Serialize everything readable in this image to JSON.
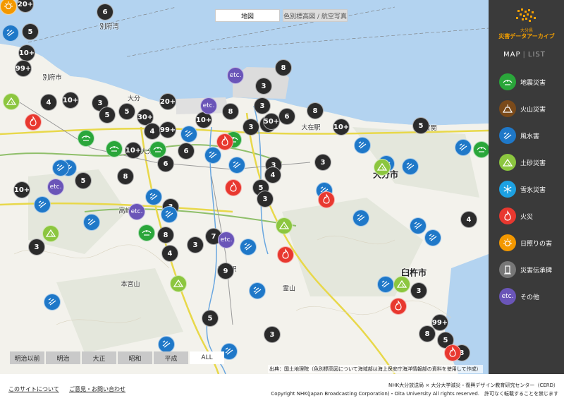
{
  "map_toggle": {
    "map": "地図",
    "terrain": "色別標高図 / 航空写真"
  },
  "places": [
    {
      "name": "大分市",
      "cls": "big"
    },
    {
      "name": "臼杵市",
      "cls": "big"
    },
    {
      "name": "別府市",
      "cls": ""
    },
    {
      "name": "大分",
      "cls": ""
    },
    {
      "name": "大分駅",
      "cls": ""
    },
    {
      "name": "別府湾",
      "cls": ""
    },
    {
      "name": "高崎山",
      "cls": ""
    },
    {
      "name": "本宮山",
      "cls": ""
    },
    {
      "name": "霊山",
      "cls": ""
    },
    {
      "name": "鶴崎駅",
      "cls": ""
    },
    {
      "name": "大在駅",
      "cls": ""
    },
    {
      "name": "佐賀関",
      "cls": ""
    }
  ],
  "markers": [
    {
      "kind": "cluster",
      "label": "20+"
    },
    {
      "kind": "cluster",
      "label": "6"
    },
    {
      "kind": "cluster",
      "label": "5"
    },
    {
      "kind": "cluster",
      "label": "10+"
    },
    {
      "kind": "cluster",
      "label": "99+"
    },
    {
      "kind": "cluster",
      "label": "8"
    },
    {
      "kind": "cluster",
      "label": "3"
    },
    {
      "kind": "cluster",
      "label": "4"
    },
    {
      "kind": "cluster",
      "label": "10+"
    },
    {
      "kind": "cluster",
      "label": "3"
    },
    {
      "kind": "cluster",
      "label": "5"
    },
    {
      "kind": "cluster",
      "label": "5"
    },
    {
      "kind": "cluster",
      "label": "30+"
    },
    {
      "kind": "cluster",
      "label": "4"
    },
    {
      "kind": "cluster",
      "label": "20+"
    },
    {
      "kind": "cluster",
      "label": "8"
    },
    {
      "kind": "cluster",
      "label": "99+"
    },
    {
      "kind": "cluster",
      "label": "5"
    },
    {
      "kind": "cluster",
      "label": "10+"
    },
    {
      "kind": "cluster",
      "label": "3"
    },
    {
      "kind": "cluster",
      "label": "3"
    },
    {
      "kind": "cluster",
      "label": "50+"
    },
    {
      "kind": "cluster",
      "label": "6"
    },
    {
      "kind": "cluster",
      "label": "8"
    },
    {
      "kind": "cluster",
      "label": "10+"
    },
    {
      "kind": "cluster",
      "label": "5"
    },
    {
      "kind": "cluster",
      "label": "10+"
    },
    {
      "kind": "cluster",
      "label": "6"
    },
    {
      "kind": "cluster",
      "label": "3"
    },
    {
      "kind": "cluster",
      "label": "6"
    },
    {
      "kind": "cluster",
      "label": "5"
    },
    {
      "kind": "cluster",
      "label": "8"
    },
    {
      "kind": "cluster",
      "label": "3"
    },
    {
      "kind": "cluster",
      "label": "4"
    },
    {
      "kind": "cluster",
      "label": "5"
    },
    {
      "kind": "cluster",
      "label": "3"
    },
    {
      "kind": "cluster",
      "label": "3"
    },
    {
      "kind": "cluster",
      "label": "10+"
    },
    {
      "kind": "cluster",
      "label": "3"
    },
    {
      "kind": "cluster",
      "label": "8"
    },
    {
      "kind": "cluster",
      "label": "7"
    },
    {
      "kind": "cluster",
      "label": "3"
    },
    {
      "kind": "cluster",
      "label": "4"
    },
    {
      "kind": "cluster",
      "label": "9"
    },
    {
      "kind": "cluster",
      "label": "5"
    },
    {
      "kind": "cluster",
      "label": "3"
    },
    {
      "kind": "cluster",
      "label": "4"
    },
    {
      "kind": "cluster",
      "label": "3"
    },
    {
      "kind": "cluster",
      "label": "8"
    },
    {
      "kind": "cluster",
      "label": "99+"
    },
    {
      "kind": "cluster",
      "label": "5"
    },
    {
      "kind": "cluster",
      "label": "3"
    },
    {
      "kind": "etc",
      "label": "etc."
    },
    {
      "kind": "etc",
      "label": "etc."
    },
    {
      "kind": "etc",
      "label": "etc."
    },
    {
      "kind": "etc",
      "label": "etc."
    },
    {
      "kind": "etc",
      "label": "etc."
    },
    {
      "kind": "flood",
      "label": ""
    },
    {
      "kind": "flood",
      "label": ""
    },
    {
      "kind": "flood",
      "label": ""
    },
    {
      "kind": "flood",
      "label": ""
    },
    {
      "kind": "flood",
      "label": ""
    },
    {
      "kind": "flood",
      "label": ""
    },
    {
      "kind": "flood",
      "label": ""
    },
    {
      "kind": "flood",
      "label": ""
    },
    {
      "kind": "flood",
      "label": ""
    },
    {
      "kind": "flood",
      "label": ""
    },
    {
      "kind": "flood",
      "label": ""
    },
    {
      "kind": "flood",
      "label": ""
    },
    {
      "kind": "flood",
      "label": ""
    },
    {
      "kind": "flood",
      "label": ""
    },
    {
      "kind": "flood",
      "label": ""
    },
    {
      "kind": "flood",
      "label": ""
    },
    {
      "kind": "flood",
      "label": ""
    },
    {
      "kind": "flood",
      "label": ""
    },
    {
      "kind": "flood",
      "label": ""
    },
    {
      "kind": "flood",
      "label": ""
    },
    {
      "kind": "flood",
      "label": ""
    },
    {
      "kind": "flood",
      "label": ""
    },
    {
      "kind": "flood",
      "label": ""
    },
    {
      "kind": "flood",
      "label": ""
    },
    {
      "kind": "quake",
      "label": ""
    },
    {
      "kind": "quake",
      "label": ""
    },
    {
      "kind": "quake",
      "label": ""
    },
    {
      "kind": "quake",
      "label": ""
    },
    {
      "kind": "quake",
      "label": ""
    },
    {
      "kind": "quake",
      "label": ""
    },
    {
      "kind": "landslide",
      "label": ""
    },
    {
      "kind": "landslide",
      "label": ""
    },
    {
      "kind": "landslide",
      "label": ""
    },
    {
      "kind": "landslide",
      "label": ""
    },
    {
      "kind": "landslide",
      "label": ""
    },
    {
      "kind": "landslide",
      "label": ""
    },
    {
      "kind": "fire",
      "label": ""
    },
    {
      "kind": "fire",
      "label": ""
    },
    {
      "kind": "fire",
      "label": ""
    },
    {
      "kind": "fire",
      "label": ""
    },
    {
      "kind": "fire",
      "label": ""
    },
    {
      "kind": "fire",
      "label": ""
    },
    {
      "kind": "fire",
      "label": ""
    },
    {
      "kind": "drought",
      "label": ""
    }
  ],
  "eras": [
    {
      "label": "明治以前",
      "active": false
    },
    {
      "label": "明治",
      "active": false
    },
    {
      "label": "大正",
      "active": false
    },
    {
      "label": "昭和",
      "active": false
    },
    {
      "label": "平成",
      "active": false
    },
    {
      "label": "ALL",
      "active": true
    }
  ],
  "credit": "出典：国土地理院（色別標高図について海域部は海上保安庁海洋情報部の資料を使用して作成）",
  "sidebar": {
    "logo_sub": "大分県",
    "logo_title": "災害データアーカイブ",
    "tab_map": "MAP",
    "tab_list": "LIST",
    "legend": [
      {
        "key": "quake",
        "label": "地震災害",
        "color": "#2aa63a"
      },
      {
        "key": "volcano",
        "label": "火山災害",
        "color": "#7a4a1a"
      },
      {
        "key": "flood",
        "label": "風水害",
        "color": "#1f78c8"
      },
      {
        "key": "landslide",
        "label": "土砂災害",
        "color": "#8cc63f"
      },
      {
        "key": "snow",
        "label": "雪氷災害",
        "color": "#1da1e2"
      },
      {
        "key": "fire",
        "label": "火災",
        "color": "#e8382f"
      },
      {
        "key": "drought",
        "label": "日照りの害",
        "color": "#f39800"
      },
      {
        "key": "monument",
        "label": "災害伝承碑",
        "color": "#777777"
      },
      {
        "key": "etc",
        "label": "その他",
        "color": "#6a55b8"
      }
    ]
  },
  "footer": {
    "about": "このサイトについて",
    "contact": "ご意見・お問い合わせ",
    "org": "NHK大分放送局 × 大分大学減災・復興デザイン教育研究センター（CERD）",
    "copyright": "Copyright NHK(Japan Broadcasting Corporation)・Oita University All rights reserved.　許可なく転載することを禁じます"
  }
}
